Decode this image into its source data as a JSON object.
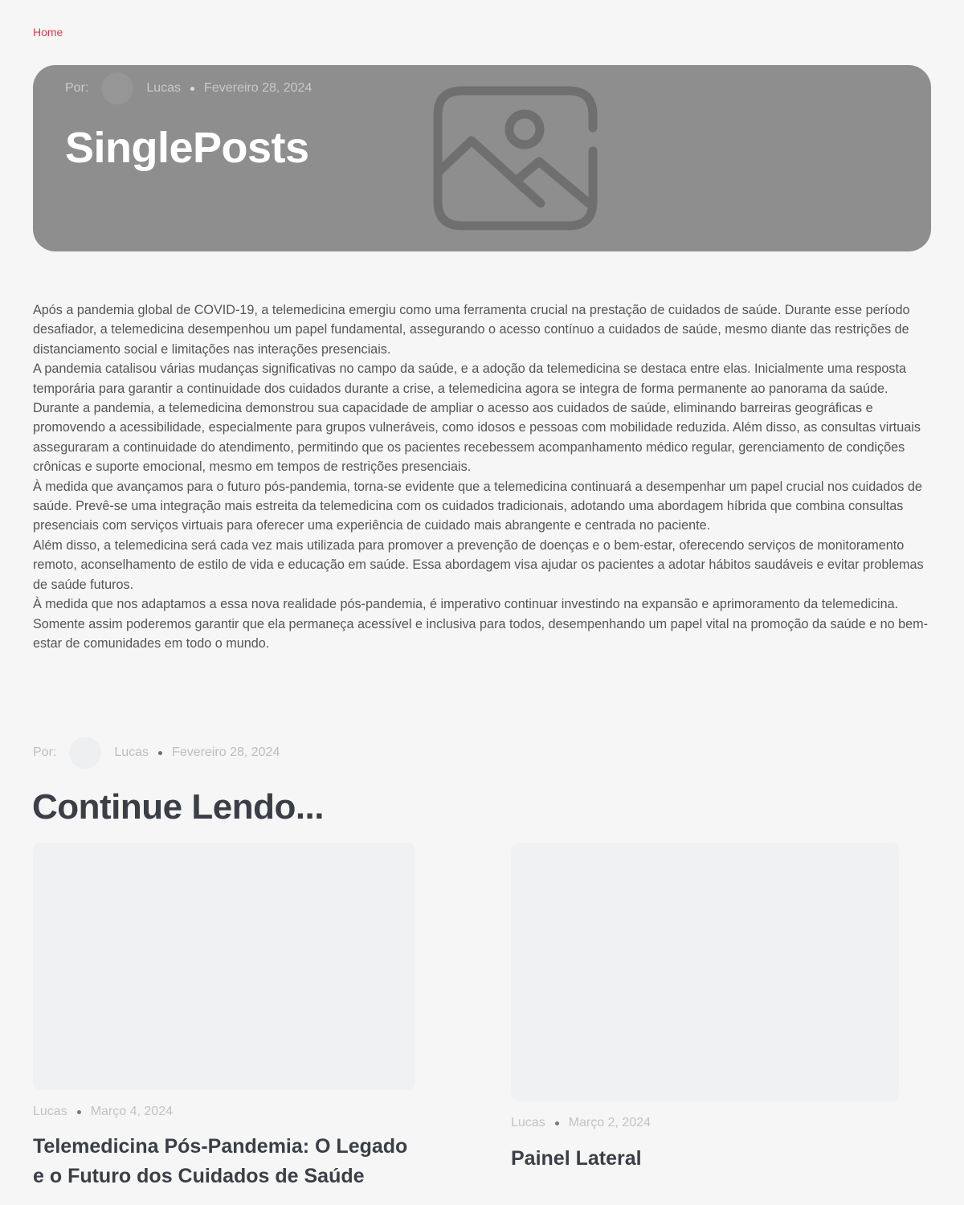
{
  "breadcrumb": {
    "home_label": "Home"
  },
  "hero": {
    "by_label": "Por:",
    "author": "Lucas",
    "date": "Fevereiro 28, 2024",
    "title": "SinglePosts",
    "image_icon": "image-placeholder-icon"
  },
  "article": {
    "paragraphs": [
      "Após a pandemia global de COVID-19, a telemedicina emergiu como uma ferramenta crucial na prestação de cuidados de saúde. Durante esse período desafiador, a telemedicina desempenhou um papel fundamental, assegurando o acesso contínuo a cuidados de saúde, mesmo diante das restrições de distanciamento social e limitações nas interações presenciais.",
      "A pandemia catalisou várias mudanças significativas no campo da saúde, e a adoção da telemedicina se destaca entre elas. Inicialmente uma resposta temporária para garantir a continuidade dos cuidados durante a crise, a telemedicina agora se integra de forma permanente ao panorama da saúde.",
      "Durante a pandemia, a telemedicina demonstrou sua capacidade de ampliar o acesso aos cuidados de saúde, eliminando barreiras geográficas e promovendo a acessibilidade, especialmente para grupos vulneráveis, como idosos e pessoas com mobilidade reduzida. Além disso, as consultas virtuais asseguraram a continuidade do atendimento, permitindo que os pacientes recebessem acompanhamento médico regular, gerenciamento de condições crônicas e suporte emocional, mesmo em tempos de restrições presenciais.",
      "À medida que avançamos para o futuro pós-pandemia, torna-se evidente que a telemedicina continuará a desempenhar um papel crucial nos cuidados de saúde. Prevê-se uma integração mais estreita da telemedicina com os cuidados tradicionais, adotando uma abordagem híbrida que combina consultas presenciais com serviços virtuais para oferecer uma experiência de cuidado mais abrangente e centrada no paciente.",
      "Além disso, a telemedicina será cada vez mais utilizada para promover a prevenção de doenças e o bem-estar, oferecendo serviços de monitoramento remoto, aconselhamento de estilo de vida e educação em saúde. Essa abordagem visa ajudar os pacientes a adotar hábitos saudáveis e evitar problemas de saúde futuros.",
      "À medida que nos adaptamos a essa nova realidade pós-pandemia, é imperativo continuar investindo na expansão e aprimoramento da telemedicina. Somente assim poderemos garantir que ela permaneça acessível e inclusiva para todos, desempenhando um papel vital na promoção da saúde e no bem-estar de comunidades em todo o mundo."
    ]
  },
  "author_meta": {
    "by_label": "Por:",
    "author": "Lucas",
    "date": "Fevereiro 28, 2024"
  },
  "continue_reading": {
    "heading": "Continue Lendo...",
    "cards": [
      {
        "author": "Lucas",
        "date": "Março 4, 2024",
        "title": "Telemedicina Pós-Pandemia: O Legado e o Futuro dos Cuidados de Saúde"
      },
      {
        "author": "Lucas",
        "date": "Março 2, 2024",
        "title": "Painel Lateral"
      }
    ]
  },
  "colors": {
    "accent": "#e3374e",
    "hero_bg": "#8e8e8e",
    "heading": "#3b3f45",
    "page_bg": "#f6f6f6"
  }
}
